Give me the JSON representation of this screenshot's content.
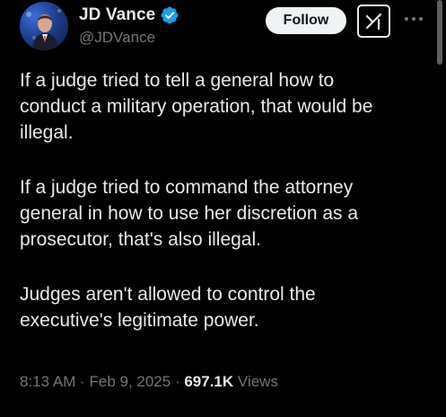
{
  "author": {
    "name": "JD Vance",
    "handle": "@JDVance",
    "verified": true,
    "avatar": "profile-photo"
  },
  "actions": {
    "follow_label": "Follow",
    "grok_icon": "grok-icon",
    "more_icon": "more-options-icon"
  },
  "tweet": {
    "paragraphs": [
      "If a judge tried to tell a general how to\nconduct a military operation, that would be\nillegal.",
      "If a judge tried to command the attorney\ngeneral in how to use her discretion as a\nprosecutor, that's also illegal.",
      "Judges aren't allowed to control the\nexecutive's legitimate power."
    ]
  },
  "meta": {
    "time": "8:13 AM",
    "separator": " · ",
    "date": "Feb 9, 2025",
    "views_count": "697.1K",
    "views_label": "Views"
  },
  "colors": {
    "background": "#000000",
    "text_primary": "#e7e9ea",
    "text_secondary": "#71767b",
    "verified_badge": "#1d9bf0",
    "follow_button_bg": "#eff3f4"
  }
}
